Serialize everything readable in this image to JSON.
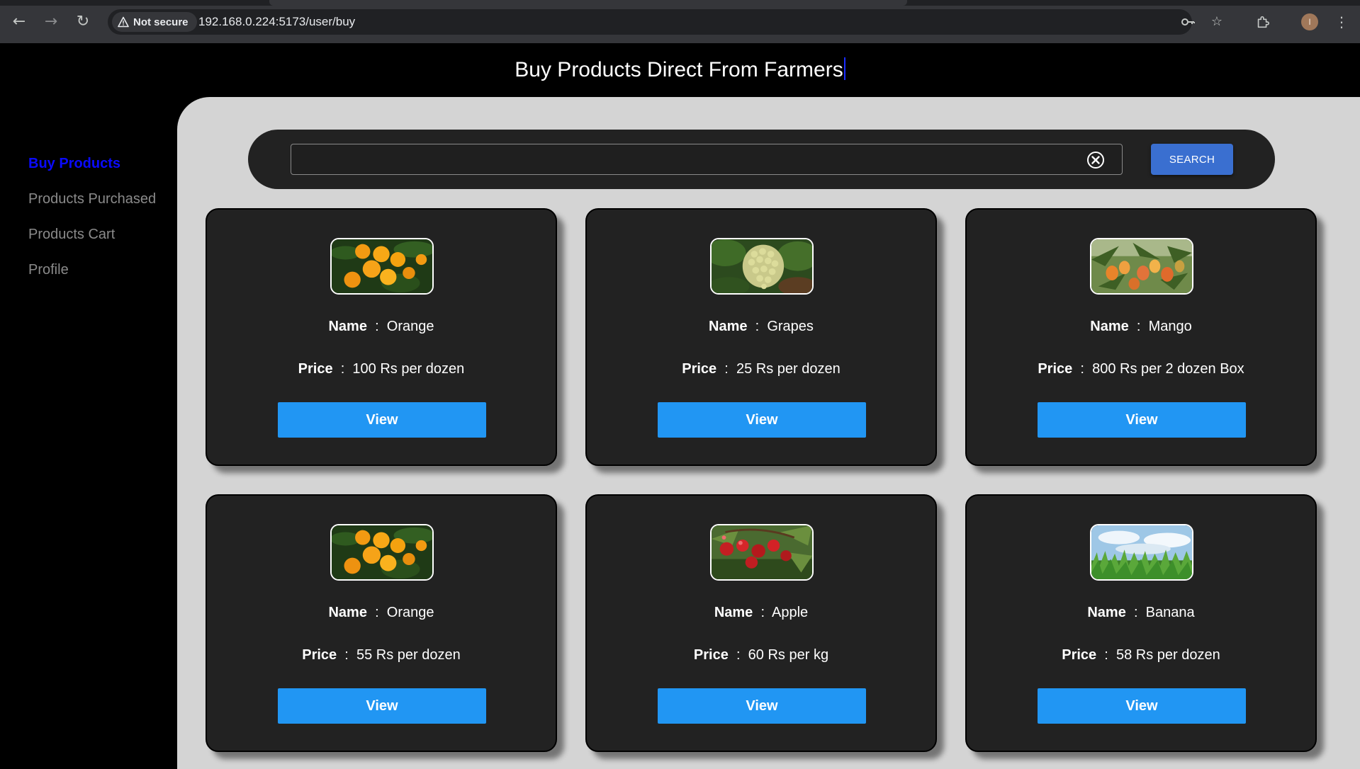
{
  "browser": {
    "security_label": "Not secure",
    "url": "192.168.0.224:5173/user/buy",
    "avatar_initial": "I"
  },
  "header": {
    "title": "Buy Products Direct From Farmers"
  },
  "sidebar": {
    "items": [
      {
        "label": "Buy Products",
        "active": true
      },
      {
        "label": "Products Purchased",
        "active": false
      },
      {
        "label": "Products Cart",
        "active": false
      },
      {
        "label": "Profile",
        "active": false
      }
    ]
  },
  "search": {
    "value": "",
    "button_label": "SEARCH"
  },
  "labels": {
    "name": "Name",
    "price": "Price",
    "separator": ":",
    "view": "View"
  },
  "products": [
    {
      "name": "Orange",
      "price": "100 Rs per dozen",
      "image": "oranges"
    },
    {
      "name": "Grapes",
      "price": "25 Rs per dozen",
      "image": "grapes"
    },
    {
      "name": "Mango",
      "price": "800 Rs per 2 dozen Box",
      "image": "mangoes"
    },
    {
      "name": "Orange",
      "price": "55 Rs per dozen",
      "image": "oranges"
    },
    {
      "name": "Apple",
      "price": "60 Rs per kg",
      "image": "cherries"
    },
    {
      "name": "Banana",
      "price": "58 Rs per dozen",
      "image": "crop-field"
    }
  ],
  "colors": {
    "active_nav": "#0a0aff",
    "view_button": "#2196f3",
    "search_button": "#3a6fd0",
    "panel": "#d4d4d4",
    "card": "#222222"
  }
}
